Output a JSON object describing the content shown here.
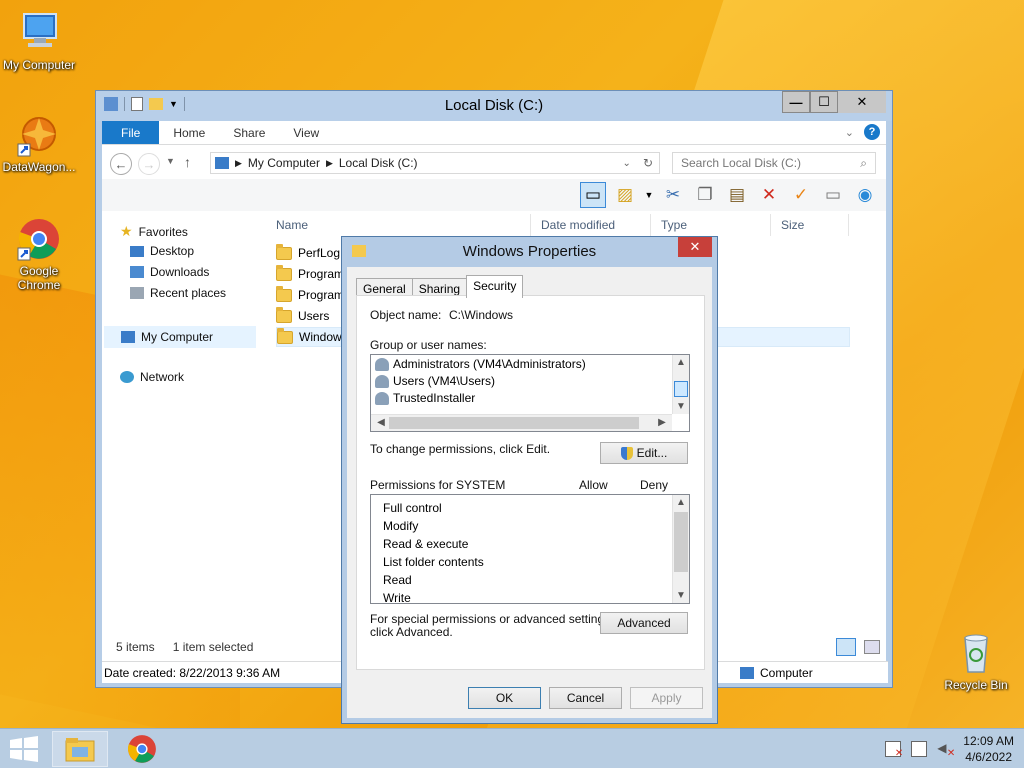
{
  "desktop": {
    "icons": [
      {
        "label": "My Computer"
      },
      {
        "label": "DataWagon..."
      },
      {
        "label": "Google Chrome"
      },
      {
        "label": "Recycle Bin"
      }
    ]
  },
  "explorer": {
    "title": "Local Disk (C:)",
    "tabs": [
      "File",
      "Home",
      "Share",
      "View"
    ],
    "address": {
      "root": "My Computer",
      "current": "Local Disk (C:)"
    },
    "search_placeholder": "Search Local Disk (C:)",
    "nav": {
      "favorites": "Favorites",
      "desktop": "Desktop",
      "downloads": "Downloads",
      "recent": "Recent places",
      "my_computer": "My Computer",
      "network": "Network"
    },
    "columns": [
      "Name",
      "Date modified",
      "Type",
      "Size"
    ],
    "files": [
      "PerfLog",
      "Program",
      "Program",
      "Users",
      "Window"
    ],
    "status": {
      "items": "5 items",
      "selected": "1 item selected"
    },
    "details": {
      "date_created": "Date created: 8/22/2013 9:36 AM",
      "location": "Computer"
    }
  },
  "properties": {
    "title": "Windows Properties",
    "tabs": [
      "General",
      "Sharing",
      "Security"
    ],
    "active_tab": "Security",
    "object_name_label": "Object name:",
    "object_name_value": "C:\\Windows",
    "group_label": "Group or user names:",
    "groups": [
      "Administrators (VM4\\Administrators)",
      "Users (VM4\\Users)",
      "TrustedInstaller"
    ],
    "change_text": "To change permissions, click Edit.",
    "edit_label": "Edit...",
    "perm_label": "Permissions for SYSTEM",
    "allow_label": "Allow",
    "deny_label": "Deny",
    "permissions": [
      "Full control",
      "Modify",
      "Read & execute",
      "List folder contents",
      "Read",
      "Write"
    ],
    "special_text_1": "For special permissions or advanced settings,",
    "special_text_2": "click Advanced.",
    "advanced_label": "Advanced",
    "ok_label": "OK",
    "cancel_label": "Cancel",
    "apply_label": "Apply"
  },
  "taskbar": {
    "time": "12:09 AM",
    "date": "4/6/2022"
  }
}
